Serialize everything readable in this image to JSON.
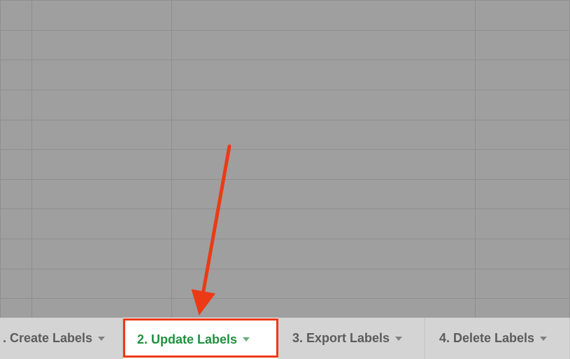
{
  "tabs": {
    "create": {
      "label": ". Create Labels"
    },
    "update": {
      "label": "2. Update Labels"
    },
    "export": {
      "label": "3. Export Labels"
    },
    "delete": {
      "label": "4. Delete Labels"
    }
  },
  "annotation": {
    "arrow_color": "#ec3a16",
    "active_tab_color": "#1f913f"
  }
}
